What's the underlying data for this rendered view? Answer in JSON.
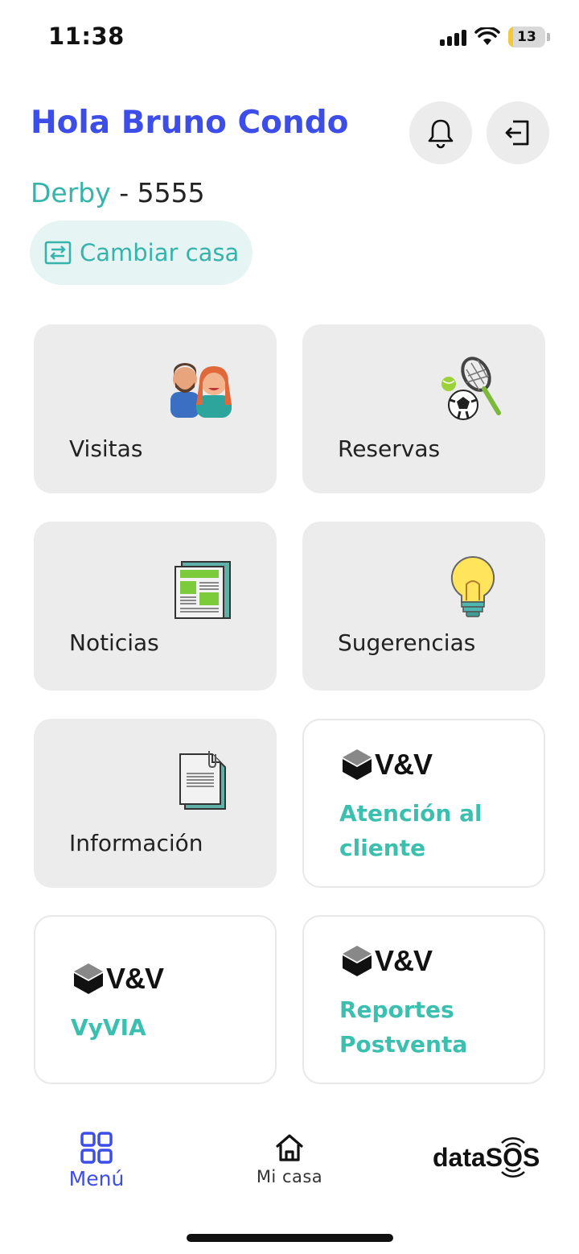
{
  "status_bar": {
    "time": "11:38",
    "battery": "13"
  },
  "header": {
    "greeting": "Hola Bruno Condo",
    "house_name": "Derby",
    "house_separator": " - ",
    "house_number": "5555",
    "change_house_label": "Cambiar casa"
  },
  "tiles": {
    "visitas": "Visitas",
    "reservas": "Reservas",
    "noticias": "Noticias",
    "sugerencias": "Sugerencias",
    "informacion": "Información",
    "atencion_line1": "Atención al",
    "atencion_line2": "cliente",
    "vyvia": "VyVIA",
    "reportes_line1": "Reportes",
    "reportes_line2": "Postventa",
    "logo_text": "V&V"
  },
  "nav": {
    "menu": "Menú",
    "home": "Mi casa",
    "brand_prefix": "data",
    "brand_suffix": "SOS"
  },
  "colors": {
    "primary": "#3d4de8",
    "teal": "#36b3aa",
    "tile_bg": "#ececec"
  }
}
